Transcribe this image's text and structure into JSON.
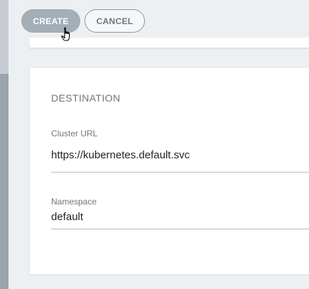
{
  "toolbar": {
    "create_label": "CREATE",
    "cancel_label": "CANCEL"
  },
  "destination": {
    "section_title": "DESTINATION",
    "cluster_url": {
      "label": "Cluster URL",
      "value": "https://kubernetes.default.svc"
    },
    "namespace": {
      "label": "Namespace",
      "value": "default"
    }
  },
  "icons": {
    "cursor": "hand-pointer-icon"
  },
  "colors": {
    "create_button": "#a3aeb6",
    "cancel_border": "#8d979e",
    "label_text": "#6b7780",
    "value_text": "#1e2328",
    "background": "#edf0f2"
  }
}
